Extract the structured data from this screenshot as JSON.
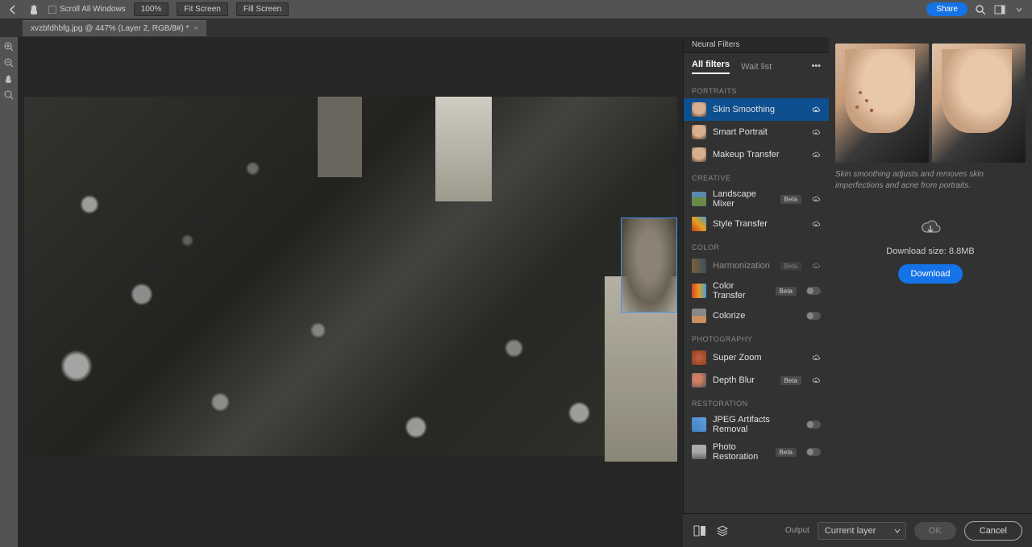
{
  "toolbar": {
    "scroll_all": "Scroll All Windows",
    "zoom": "100%",
    "fit_screen": "Fit Screen",
    "fill_screen": "Fill Screen",
    "share": "Share"
  },
  "tab": {
    "title": "xvzbfdhbfg.jpg @ 447% (Layer 2, RGB/8#) *"
  },
  "panel": {
    "title": "Neural Filters",
    "tab_all": "All filters",
    "tab_wait": "Wait list",
    "sections": {
      "portraits": "PORTRAITS",
      "creative": "CREATIVE",
      "color": "COLOR",
      "photography": "PHOTOGRAPHY",
      "restoration": "RESTORATION"
    },
    "filters": {
      "skin_smoothing": "Skin Smoothing",
      "smart_portrait": "Smart Portrait",
      "makeup_transfer": "Makeup Transfer",
      "landscape_mixer": "Landscape Mixer",
      "style_transfer": "Style Transfer",
      "harmonization": "Harmonization",
      "color_transfer": "Color Transfer",
      "colorize": "Colorize",
      "super_zoom": "Super Zoom",
      "depth_blur": "Depth Blur",
      "jpeg_artifacts": "JPEG Artifacts Removal",
      "photo_restoration": "Photo Restoration"
    },
    "beta": "Beta"
  },
  "detail": {
    "description": "Skin smoothing adjusts and removes skin imperfections and acne from portraits.",
    "download_size": "Download size: 8.8MB",
    "download_btn": "Download"
  },
  "bottom": {
    "output": "Output",
    "current_layer": "Current layer",
    "ok": "OK",
    "cancel": "Cancel"
  }
}
